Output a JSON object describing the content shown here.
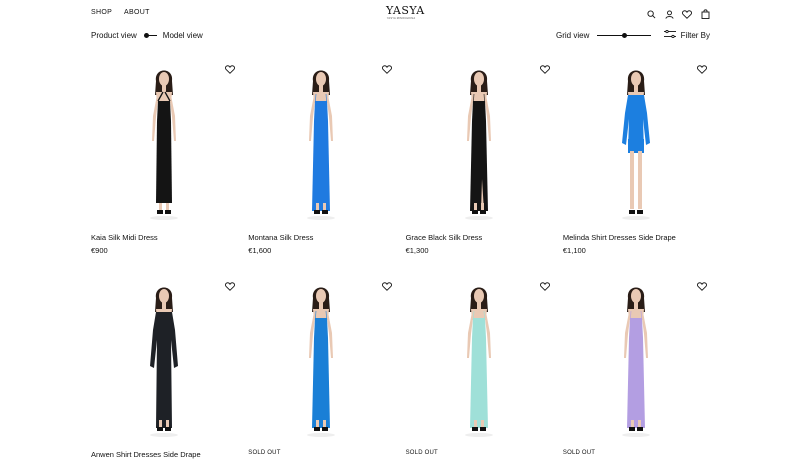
{
  "header": {
    "nav": [
      {
        "label": "SHOP"
      },
      {
        "label": "ABOUT"
      }
    ],
    "logo": {
      "mark": "YASYA",
      "tagline": "YASYA MINOCHKINA"
    },
    "icons": [
      "search-icon",
      "account-icon",
      "wishlist-icon",
      "bag-icon"
    ]
  },
  "toolbar": {
    "product_view_label": "Product view",
    "model_view_label": "Model view",
    "grid_view_label": "Grid view",
    "grid_slider_level": 0.5,
    "filter_label": "Filter By"
  },
  "colors": {
    "black_dress": "#141414",
    "blue_dress": "#1f7ae0",
    "cobalt_dress": "#1a7fd6",
    "mint_dress": "#9fe0d8",
    "lilac_dress": "#b39ee2",
    "skin": "#e9c9b4",
    "hair": "#2a1d17"
  },
  "products": [
    {
      "name": "Kaia Silk Midi Dress",
      "price": "€900",
      "status": "",
      "dress_color": "#141414"
    },
    {
      "name": "Montana Silk Dress",
      "price": "€1,600",
      "status": "",
      "dress_color": "#1f7ae0"
    },
    {
      "name": "Grace Black Silk Dress",
      "price": "€1,300",
      "status": "",
      "dress_color": "#141414"
    },
    {
      "name": "Melinda Shirt Dresses Side Drape",
      "price": "€1,100",
      "status": "",
      "dress_color": "#1c7fe0"
    },
    {
      "name": "Anwen Shirt Dresses Side Drape",
      "price": "",
      "status": "",
      "dress_color": "#1e2126"
    },
    {
      "name": "",
      "price": "",
      "status": "SOLD OUT",
      "dress_color": "#1a7fd6"
    },
    {
      "name": "",
      "price": "",
      "status": "SOLD OUT",
      "dress_color": "#9fe0d8"
    },
    {
      "name": "",
      "price": "",
      "status": "SOLD OUT",
      "dress_color": "#b39ee2"
    }
  ]
}
